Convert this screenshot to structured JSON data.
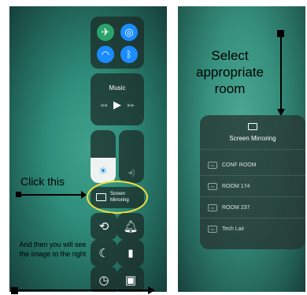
{
  "left": {
    "music_label": "Music",
    "screen_mirroring_line1": "Screen",
    "screen_mirroring_line2": "Mirroring",
    "annotation_click": "Click this",
    "annotation_then": "And then you will see the image to the right",
    "icons": {
      "airplane": "airplane-icon",
      "cellular": "cellular-data-icon",
      "wifi": "wifi-icon",
      "bluetooth": "bluetooth-icon",
      "brightness": "brightness-icon",
      "volume": "volume-icon",
      "rotation_lock": "rotation-lock-icon",
      "bell": "bell-icon",
      "moon": "moon-icon",
      "flashlight": "flashlight-icon",
      "timer": "timer-icon",
      "camera": "camera-icon"
    },
    "colors": {
      "accent": "#1e88e5",
      "highlight": "#f2de3a",
      "wifi_active": "#1a8cff",
      "airplane_active": "#2aa36a"
    }
  },
  "right": {
    "annotation_select": "Select appropriate room",
    "panel_title": "Screen Mirroring",
    "rooms": [
      "CONF ROOM",
      "ROOM 174",
      "ROOM 237",
      "Tech Lair"
    ],
    "room_badge": "atv"
  }
}
